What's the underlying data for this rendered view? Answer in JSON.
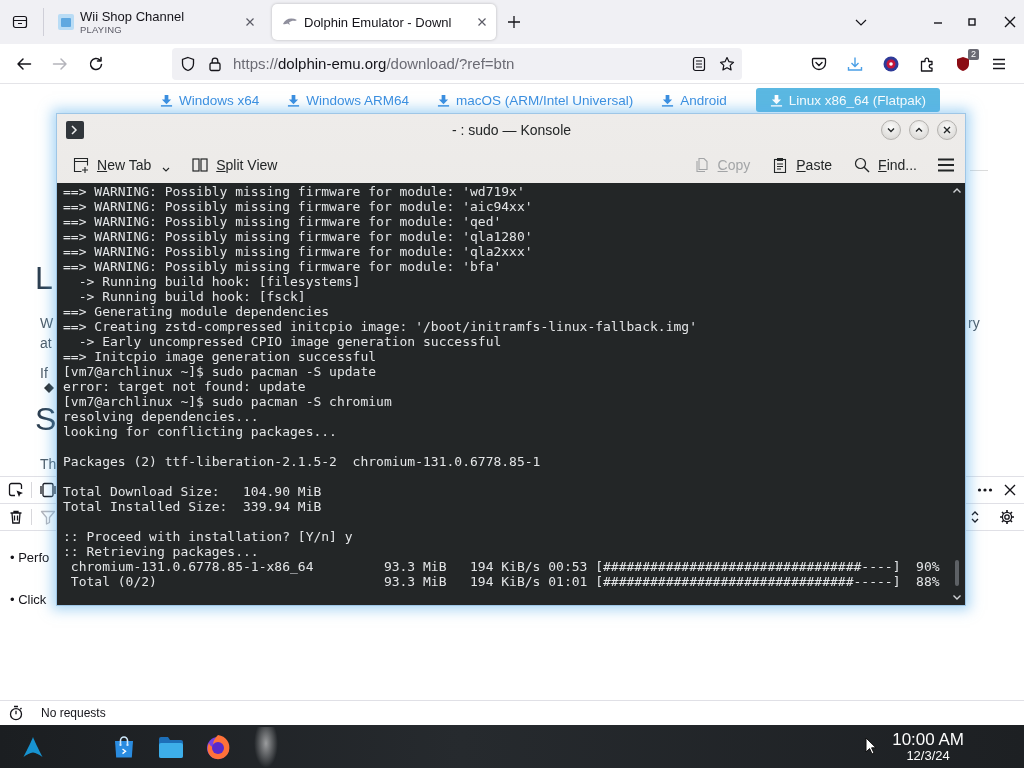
{
  "browser": {
    "tabs": [
      {
        "title": "Wii Shop Channel",
        "subtitle": "PLAYING",
        "selected": false
      },
      {
        "title": "Dolphin Emulator - Downl",
        "selected": true
      }
    ],
    "navigation": [
      {
        "kind": "back",
        "disabled": false
      },
      {
        "kind": "forward",
        "disabled": true
      },
      {
        "kind": "reload",
        "disabled": false
      }
    ],
    "address": {
      "scheme": "https://",
      "host": "dolphin-emu.org",
      "path": "/download/?ref=btn"
    },
    "extension_badge": "2"
  },
  "page": {
    "downloads": [
      {
        "kind": "link",
        "label": "Windows x64"
      },
      {
        "kind": "link",
        "label": "Windows ARM64"
      },
      {
        "kind": "link",
        "label": "macOS (ARM/Intel Universal)"
      },
      {
        "kind": "link",
        "label": "Android"
      },
      {
        "kind": "button",
        "label": "Linux x86_64 (Flatpak)"
      }
    ],
    "left_column": [
      {
        "kind": "heading",
        "text": "L"
      },
      {
        "kind": "paragraph",
        "lines": [
          "W",
          "at"
        ]
      },
      {
        "kind": "paragraph",
        "lines": [
          "If"
        ]
      },
      {
        "kind": "marker"
      },
      {
        "kind": "heading",
        "text": "S"
      },
      {
        "kind": "paragraph",
        "lines": [
          "Th"
        ]
      }
    ],
    "right_column": [
      {
        "kind": "rule"
      },
      {
        "kind": "paragraph",
        "lines": [
          "ry"
        ]
      }
    ]
  },
  "devtools": {
    "entries": [
      "• Perfo",
      "• Click"
    ],
    "status": "No requests"
  },
  "konsole": {
    "title": "- : sudo — Konsole",
    "left_actions": [
      {
        "kind": "new-tab",
        "label": "New Tab",
        "disabled": false
      },
      {
        "kind": "split-view",
        "label": "Split View",
        "disabled": false
      }
    ],
    "right_actions": [
      {
        "kind": "copy",
        "label": "Copy",
        "disabled": true
      },
      {
        "kind": "paste",
        "label": "Paste",
        "disabled": false
      },
      {
        "kind": "find",
        "label": "Find...",
        "disabled": false
      }
    ],
    "terminal": {
      "blocks": [
        [
          "==> WARNING: Possibly missing firmware for module: 'wd719x'",
          "==> WARNING: Possibly missing firmware for module: 'aic94xx'",
          "==> WARNING: Possibly missing firmware for module: 'qed'",
          "==> WARNING: Possibly missing firmware for module: 'qla1280'",
          "==> WARNING: Possibly missing firmware for module: 'qla2xxx'",
          "==> WARNING: Possibly missing firmware for module: 'bfa'",
          "  -> Running build hook: [filesystems]",
          "  -> Running build hook: [fsck]",
          "==> Generating module dependencies",
          "==> Creating zstd-compressed initcpio image: '/boot/initramfs-linux-fallback.img'",
          "  -> Early uncompressed CPIO image generation successful",
          "==> Initcpio image generation successful",
          "[vm7@archlinux ~]$ sudo pacman -S update",
          "error: target not found: update",
          "[vm7@archlinux ~]$ sudo pacman -S chromium",
          "resolving dependencies...",
          "looking for conflicting packages..."
        ],
        [
          "Packages (2) ttf-liberation-2.1.5-2  chromium-131.0.6778.85-1"
        ],
        [
          "Total Download Size:   104.90 MiB",
          "Total Installed Size:  339.94 MiB"
        ],
        [
          ":: Proceed with installation? [Y/n] y",
          ":: Retrieving packages...",
          " chromium-131.0.6778.85-1-x86_64         93.3 MiB   194 KiB/s 00:53 [#################################----]  90%",
          " Total (0/2)                             93.3 MiB   194 KiB/s 01:01 [################################-----]  88%"
        ]
      ]
    }
  },
  "taskbar": {
    "time": "10:00 AM",
    "date": "12/3/24"
  }
}
